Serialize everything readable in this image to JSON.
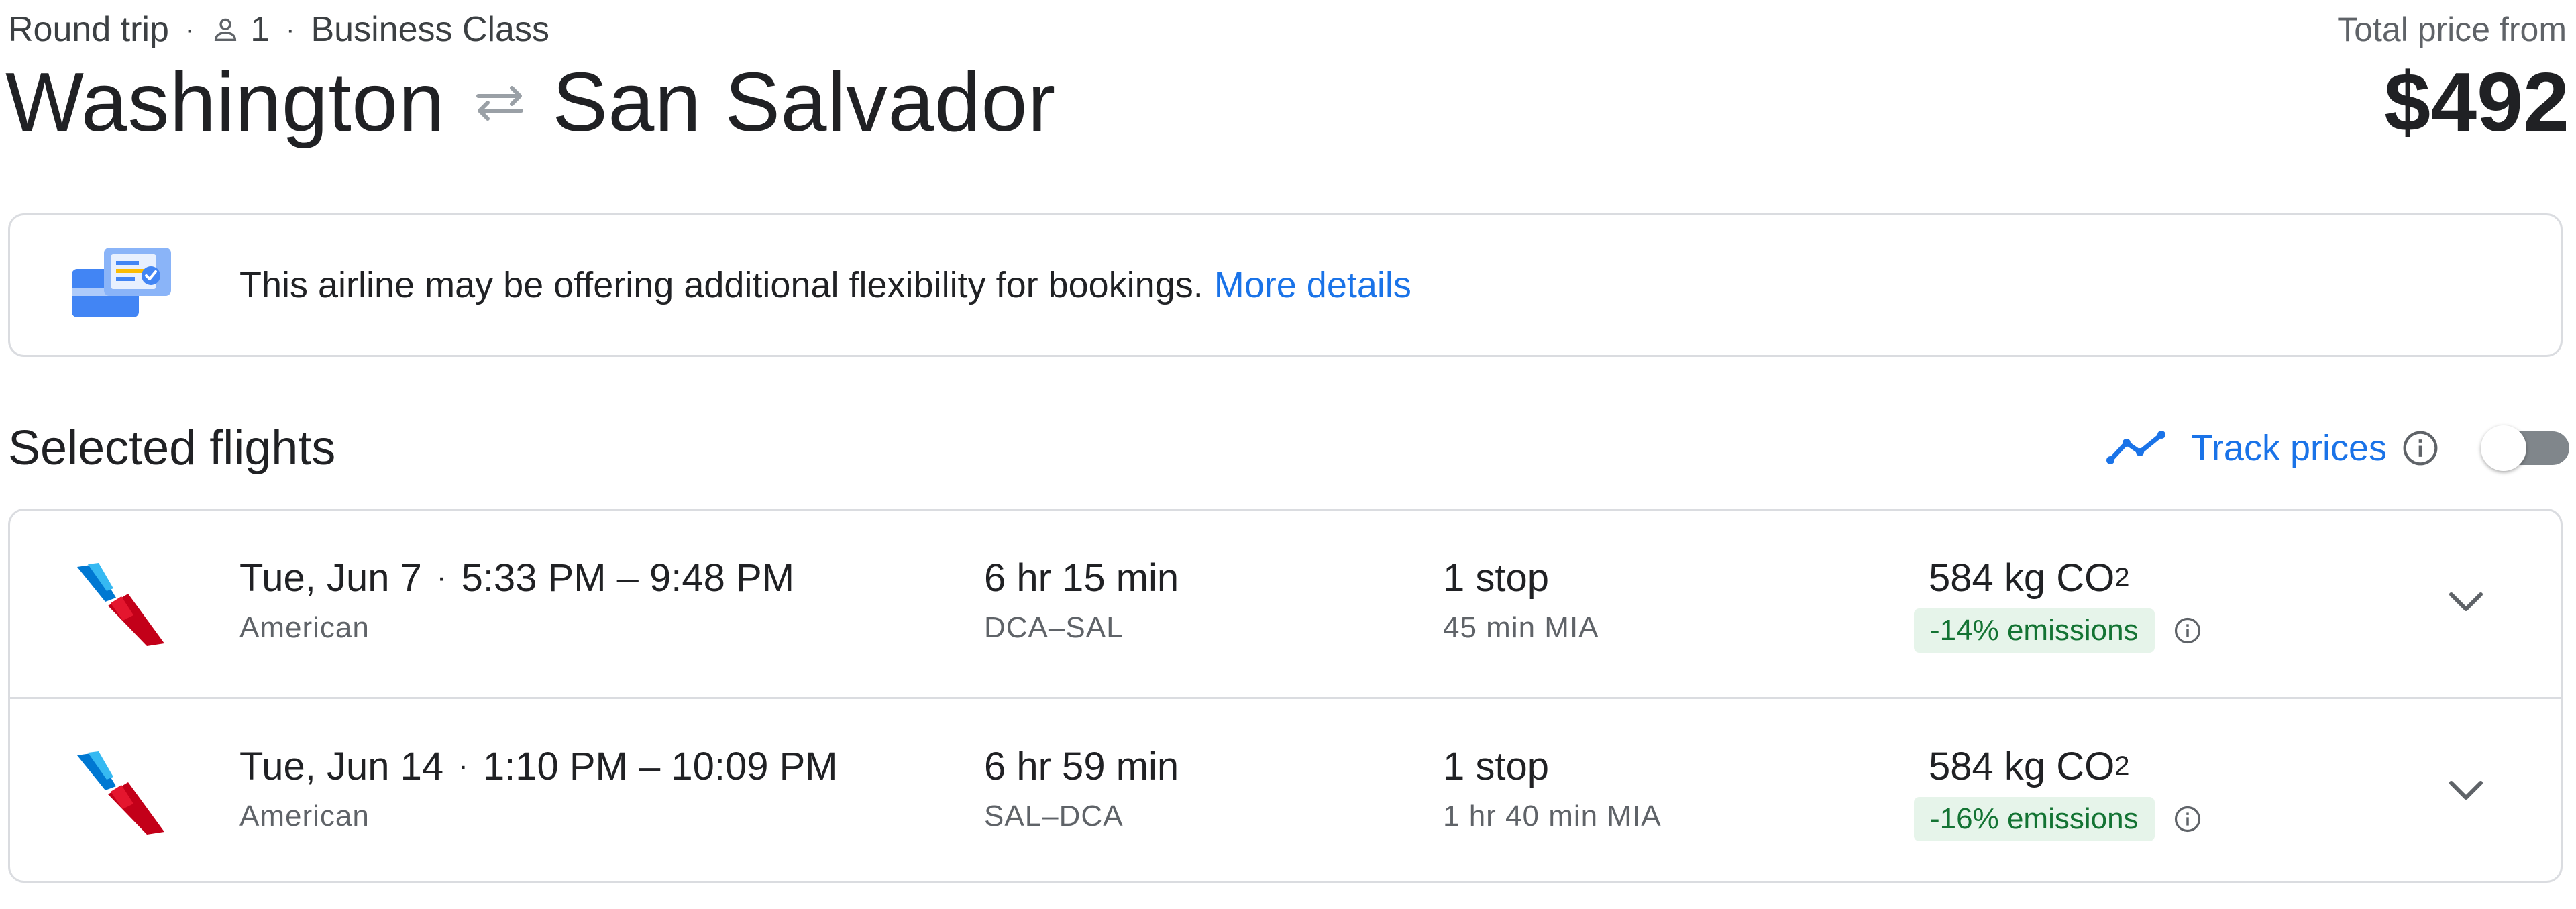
{
  "trip": {
    "type": "Round trip",
    "passengers": "1",
    "cabin": "Business Class"
  },
  "route": {
    "origin": "Washington",
    "destination": "San Salvador"
  },
  "price": {
    "label": "Total price from",
    "value": "$492"
  },
  "banner": {
    "text": "This airline may be offering additional flexibility for bookings.",
    "link": "More details"
  },
  "section": {
    "title": "Selected flights"
  },
  "track": {
    "label": "Track prices",
    "enabled": false
  },
  "flights": [
    {
      "date": "Tue, Jun 7",
      "times": "5:33 PM – 9:48 PM",
      "airline": "American",
      "duration": "6 hr 15 min",
      "route": "DCA–SAL",
      "stops": "1 stop",
      "layover": "45 min MIA",
      "co2_value": "584 kg CO",
      "co2_subscript": "2",
      "emissions": "-14% emissions"
    },
    {
      "date": "Tue, Jun 14",
      "times": "1:10 PM – 10:09 PM",
      "airline": "American",
      "duration": "6 hr 59 min",
      "route": "SAL–DCA",
      "stops": "1 stop",
      "layover": "1 hr 40 min MIA",
      "co2_value": "584 kg CO",
      "co2_subscript": "2",
      "emissions": "-16% emissions"
    }
  ],
  "colors": {
    "accent": "#1a73e8",
    "text": "#202124",
    "secondary_text": "#5f6368",
    "border": "#dadce0",
    "emissions_bg": "#e6f4ea",
    "emissions_text": "#137333",
    "toggle_track": "#80868b"
  },
  "icons": {
    "person": "person-outline-icon",
    "swap": "swap-arrows-icon",
    "banner": "ticket-flexibility-icon",
    "trend": "trend-line-icon",
    "info": "info-icon",
    "chevron": "chevron-down-icon",
    "airline": "american-airlines-logo"
  }
}
